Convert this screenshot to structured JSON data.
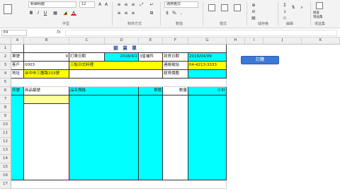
{
  "ribbon": {
    "font_name": "新細明體",
    "font_size": "12",
    "groups": {
      "font": "字型",
      "alignment": "對齊方式",
      "number": "數值",
      "styles": "樣式",
      "cells": "儲存格",
      "editing": "編輯",
      "addins": "增益集"
    },
    "number_format": "通用格式",
    "addins_labels": [
      "檢查",
      "增益集"
    ]
  },
  "formula_bar": {
    "name_box": "E4",
    "fx_label": "fx",
    "content": ""
  },
  "columns": [
    "A",
    "B",
    "C",
    "D",
    "E",
    "F",
    "G",
    "H",
    "I",
    "J",
    "K"
  ],
  "rows": [
    "1",
    "2",
    "3",
    "4",
    "5",
    "6",
    "7",
    "8",
    "9",
    "10",
    "11",
    "12",
    "13",
    "14",
    "15",
    "16",
    "17"
  ],
  "sheet": {
    "title": "銷　貨　單",
    "r2": {
      "label_a": "單號",
      "num": "9",
      "label_order_date": "訂單日期",
      "order_date": "2018/4/2",
      "note": "3星補件",
      "label_delivery": "到貨日期",
      "delivery_date": "2018/04/09"
    },
    "r3": {
      "label_a": "客戶",
      "customer_code": "0003",
      "customer_name": "三點日式料理",
      "label_phone": "連絡電話",
      "phone": "04-4213-3333"
    },
    "r4": {
      "label_a": "地址",
      "address": "台中市三團路333號",
      "label_manager": "經貨價鑑"
    },
    "headers": {
      "seq": "序號",
      "product_code": "商品編號",
      "spec": "品名規格",
      "unit_price": "單價",
      "qty": "數量",
      "subtotal": "小計"
    }
  },
  "buttons": {
    "order": "訂購"
  }
}
